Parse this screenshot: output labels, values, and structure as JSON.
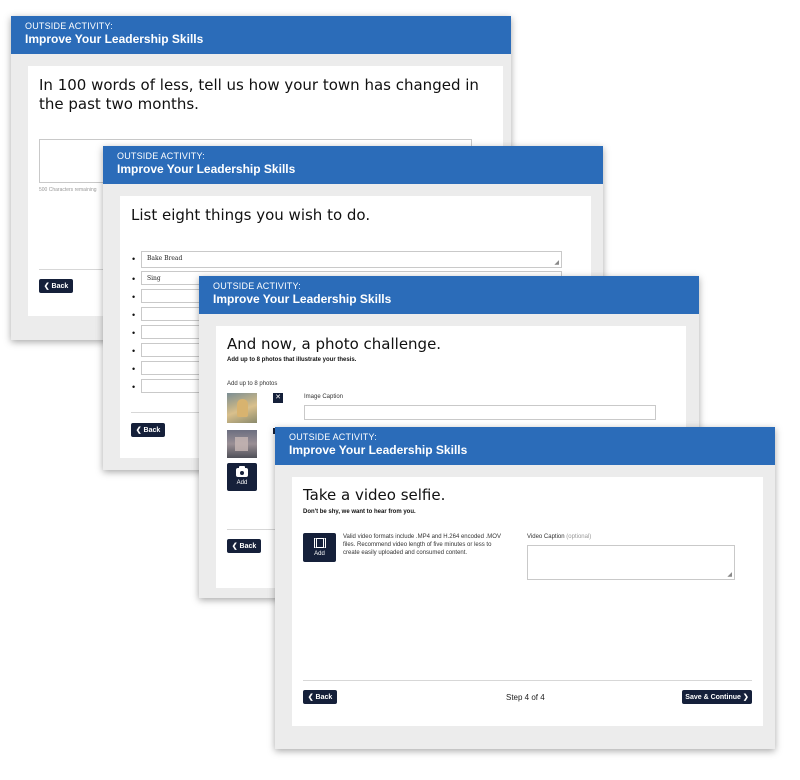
{
  "activity": {
    "kicker": "OUTSIDE ACTIVITY:",
    "title": "Improve Your Leadership Skills"
  },
  "card1": {
    "question": "In 100 words of less, tell us how your town has changed in the past two months.",
    "chars_remaining": "500 Characters remaining",
    "back": "❮ Back"
  },
  "card2": {
    "question": "List eight things you wish to do.",
    "items": [
      "Bake Bread",
      "Sing",
      "",
      "",
      "",
      "",
      "",
      ""
    ],
    "back": "❮ Back"
  },
  "card3": {
    "question": "And now, a photo challenge.",
    "subtitle": "Add up to 8 photos that illustrate your thesis.",
    "upload_label": "Add up to 8 photos",
    "caption_label": "Image Caption",
    "remove": "✕",
    "add": "Add",
    "back": "❮ Back"
  },
  "card4": {
    "question": "Take a video selfie.",
    "subtitle": "Don't be shy, we want to hear from you.",
    "add": "Add",
    "info": "Valid video formats include .MP4 and H.264 encoded .MOV files. Recommend video length of five minutes or less to create easily uploaded and consumed content.",
    "caption_label": "Video Caption",
    "caption_optional": "(optional)",
    "back": "❮ Back",
    "step": "Step 4 of 4",
    "save": "Save & Continue ❯"
  }
}
